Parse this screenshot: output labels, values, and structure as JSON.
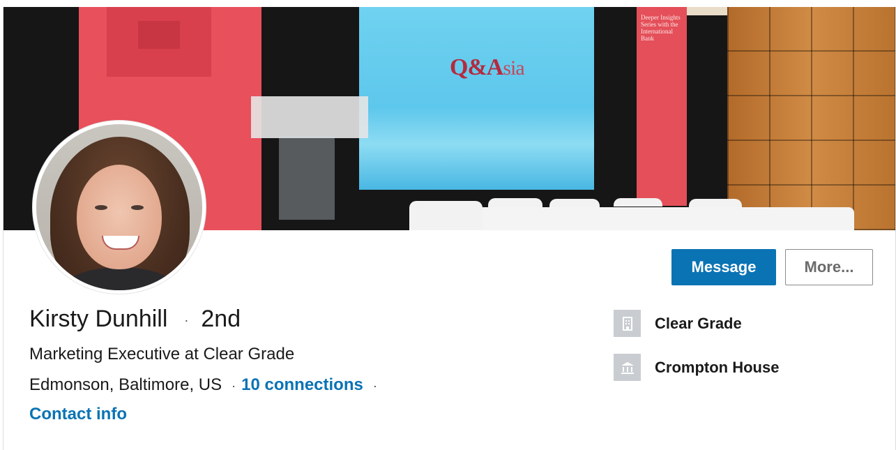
{
  "banner": {
    "screen_title_main": "Q&A",
    "screen_title_rest": "sia",
    "side_banner_text": "Deeper Insights Series with the International Bank"
  },
  "profile": {
    "name": "Kirsty Dunhill",
    "separator": "·",
    "degree": "2nd",
    "headline": "Marketing Executive at Clear Grade",
    "location": "Edmonson, Baltimore, US",
    "connections": "10 connections",
    "contact_info": "Contact info"
  },
  "actions": {
    "message": "Message",
    "more": "More..."
  },
  "sidebar": {
    "items": [
      {
        "label": "Clear Grade",
        "icon": "building-icon"
      },
      {
        "label": "Crompton House",
        "icon": "school-icon"
      }
    ]
  },
  "colors": {
    "accent": "#0a73b4",
    "text": "#1a1a1a",
    "icon_bg": "#c9cdd1"
  }
}
